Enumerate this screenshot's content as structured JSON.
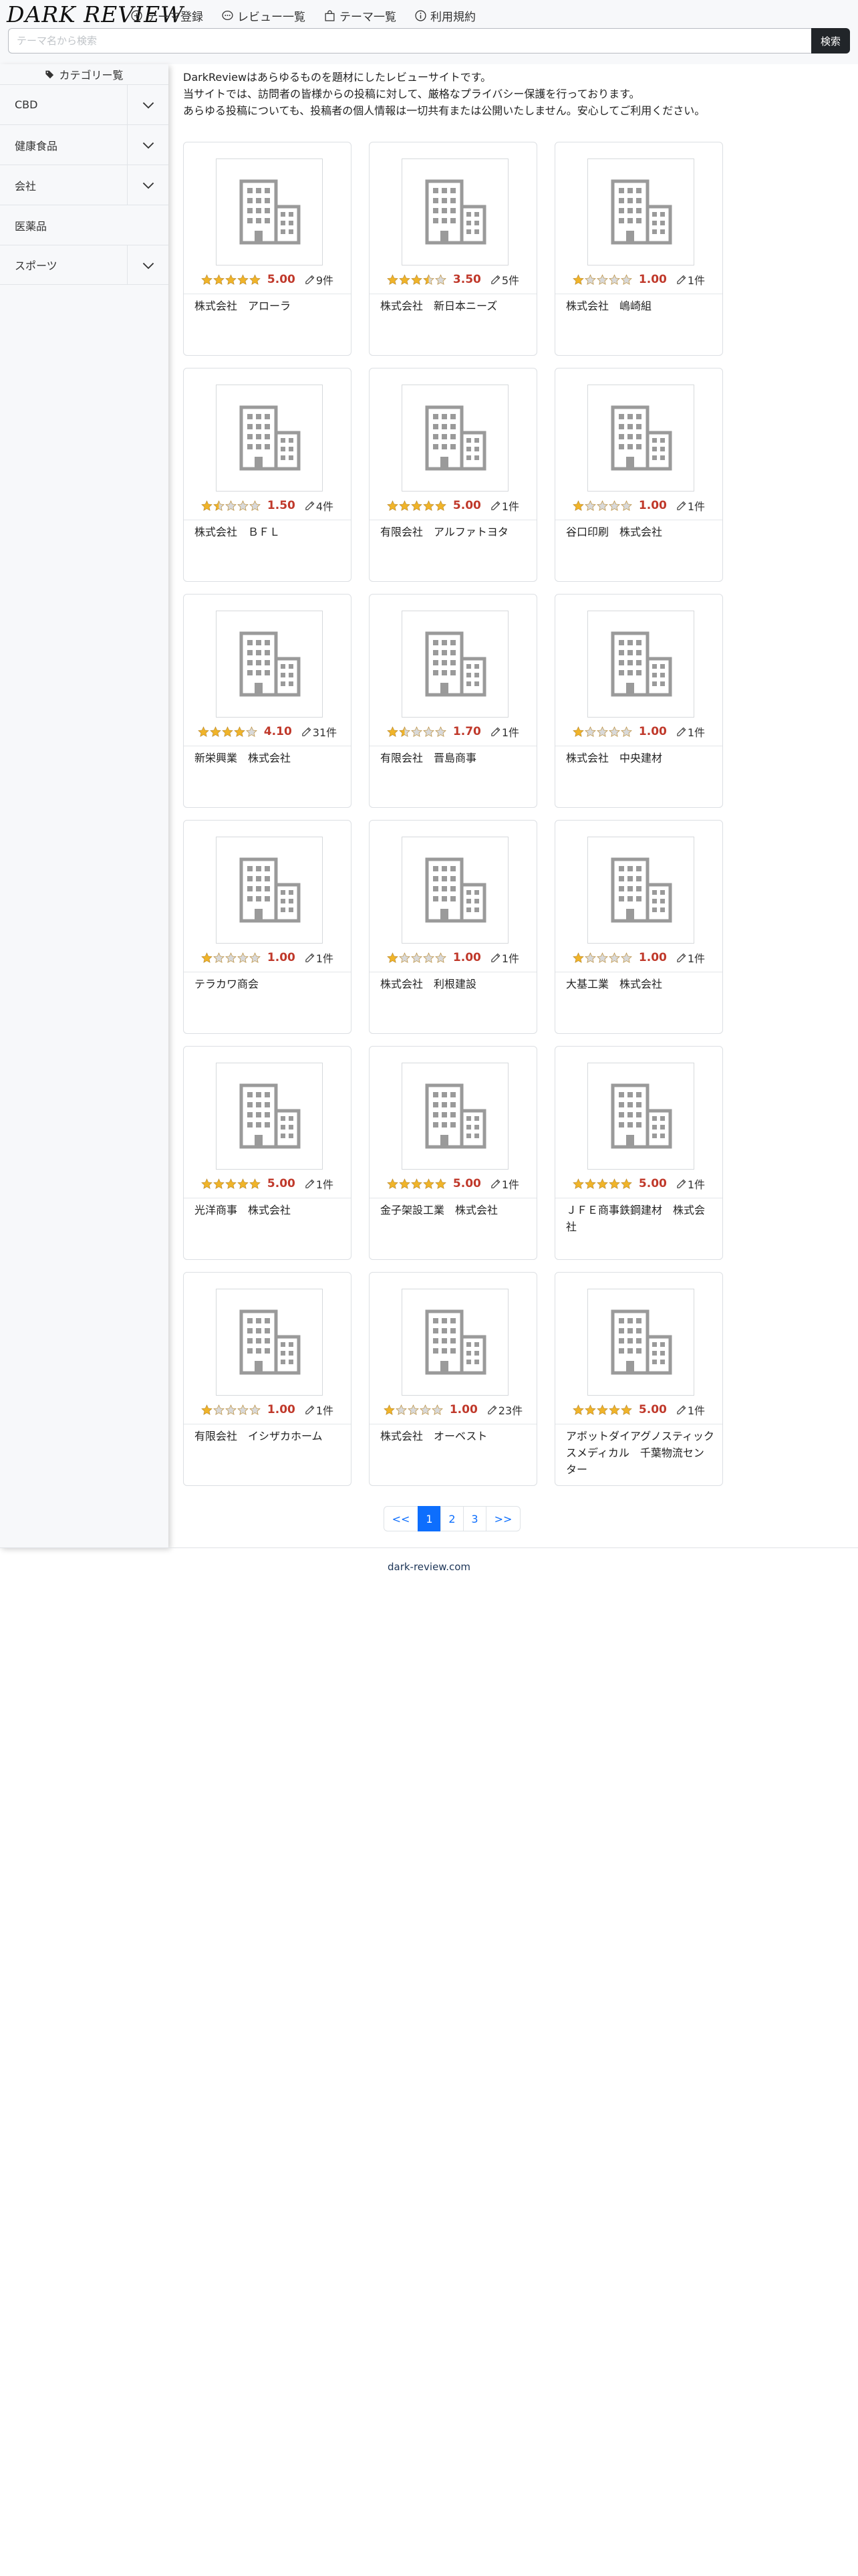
{
  "header": {
    "logo": "DARK REVIEW",
    "nav": [
      {
        "label": "テーマ登録",
        "icon": "plus-circle-icon"
      },
      {
        "label": "レビュー一覧",
        "icon": "chat-icon"
      },
      {
        "label": "テーマ一覧",
        "icon": "bag-icon"
      },
      {
        "label": "利用規約",
        "icon": "info-circle-icon"
      }
    ],
    "search": {
      "placeholder": "テーマ名から検索",
      "button": "検索"
    }
  },
  "sidebar": {
    "title": "カテゴリー覧",
    "items": [
      {
        "label": "CBD",
        "expandable": true
      },
      {
        "label": "健康食品",
        "expandable": true
      },
      {
        "label": "会社",
        "expandable": true
      },
      {
        "label": "医薬品",
        "expandable": false
      },
      {
        "label": "スポーツ",
        "expandable": true
      }
    ]
  },
  "intro": [
    "DarkReviewはあらゆるものを題材にしたレビューサイトです。",
    "当サイトでは、訪問者の皆様からの投稿に対して、厳格なプライバシー保護を行っております。",
    "あらゆる投稿についても、投稿者の個人情報は一切共有または公開いたしません。安心してご利用ください。"
  ],
  "cards": [
    {
      "name": "株式会社　アローラ",
      "score": "5.00",
      "stars": 5,
      "count": "9件"
    },
    {
      "name": "株式会社　新日本ニーズ",
      "score": "3.50",
      "stars": 3.5,
      "count": "5件"
    },
    {
      "name": "株式会社　嶋崎組",
      "score": "1.00",
      "stars": 1,
      "count": "1件"
    },
    {
      "name": "株式会社　ＢＦＬ",
      "score": "1.50",
      "stars": 1.5,
      "count": "4件"
    },
    {
      "name": "有限会社　アルファトヨタ",
      "score": "5.00",
      "stars": 5,
      "count": "1件"
    },
    {
      "name": "谷口印刷　株式会社",
      "score": "1.00",
      "stars": 1,
      "count": "1件"
    },
    {
      "name": "新栄興業　株式会社",
      "score": "4.10",
      "stars": 4,
      "count": "31件"
    },
    {
      "name": "有限会社　晋島商事",
      "score": "1.70",
      "stars": 1.5,
      "count": "1件"
    },
    {
      "name": "株式会社　中央建材",
      "score": "1.00",
      "stars": 1,
      "count": "1件"
    },
    {
      "name": "テラカワ商会",
      "score": "1.00",
      "stars": 1,
      "count": "1件"
    },
    {
      "name": "株式会社　利根建設",
      "score": "1.00",
      "stars": 1,
      "count": "1件"
    },
    {
      "name": "大基工業　株式会社",
      "score": "1.00",
      "stars": 1,
      "count": "1件"
    },
    {
      "name": "光洋商事　株式会社",
      "score": "5.00",
      "stars": 5,
      "count": "1件"
    },
    {
      "name": "金子架設工業　株式会社",
      "score": "5.00",
      "stars": 5,
      "count": "1件"
    },
    {
      "name": "ＪＦＥ商事鉄鋼建材　株式会社",
      "score": "5.00",
      "stars": 5,
      "count": "1件"
    },
    {
      "name": "有限会社　イシザカホーム",
      "score": "1.00",
      "stars": 1,
      "count": "1件"
    },
    {
      "name": "株式会社　オーベスト",
      "score": "1.00",
      "stars": 1,
      "count": "23件"
    },
    {
      "name": "アボットダイアグノスティックスメディカル　千葉物流センター",
      "score": "5.00",
      "stars": 5,
      "count": "1件"
    }
  ],
  "pagination": {
    "first": "<<",
    "pages": [
      "1",
      "2",
      "3"
    ],
    "active": "1",
    "last": ">>"
  },
  "footer": "dark-review.com",
  "colors": {
    "score": "#c0392b",
    "star": "#f0b429",
    "accent": "#0d6efd",
    "dark": "#212529"
  }
}
